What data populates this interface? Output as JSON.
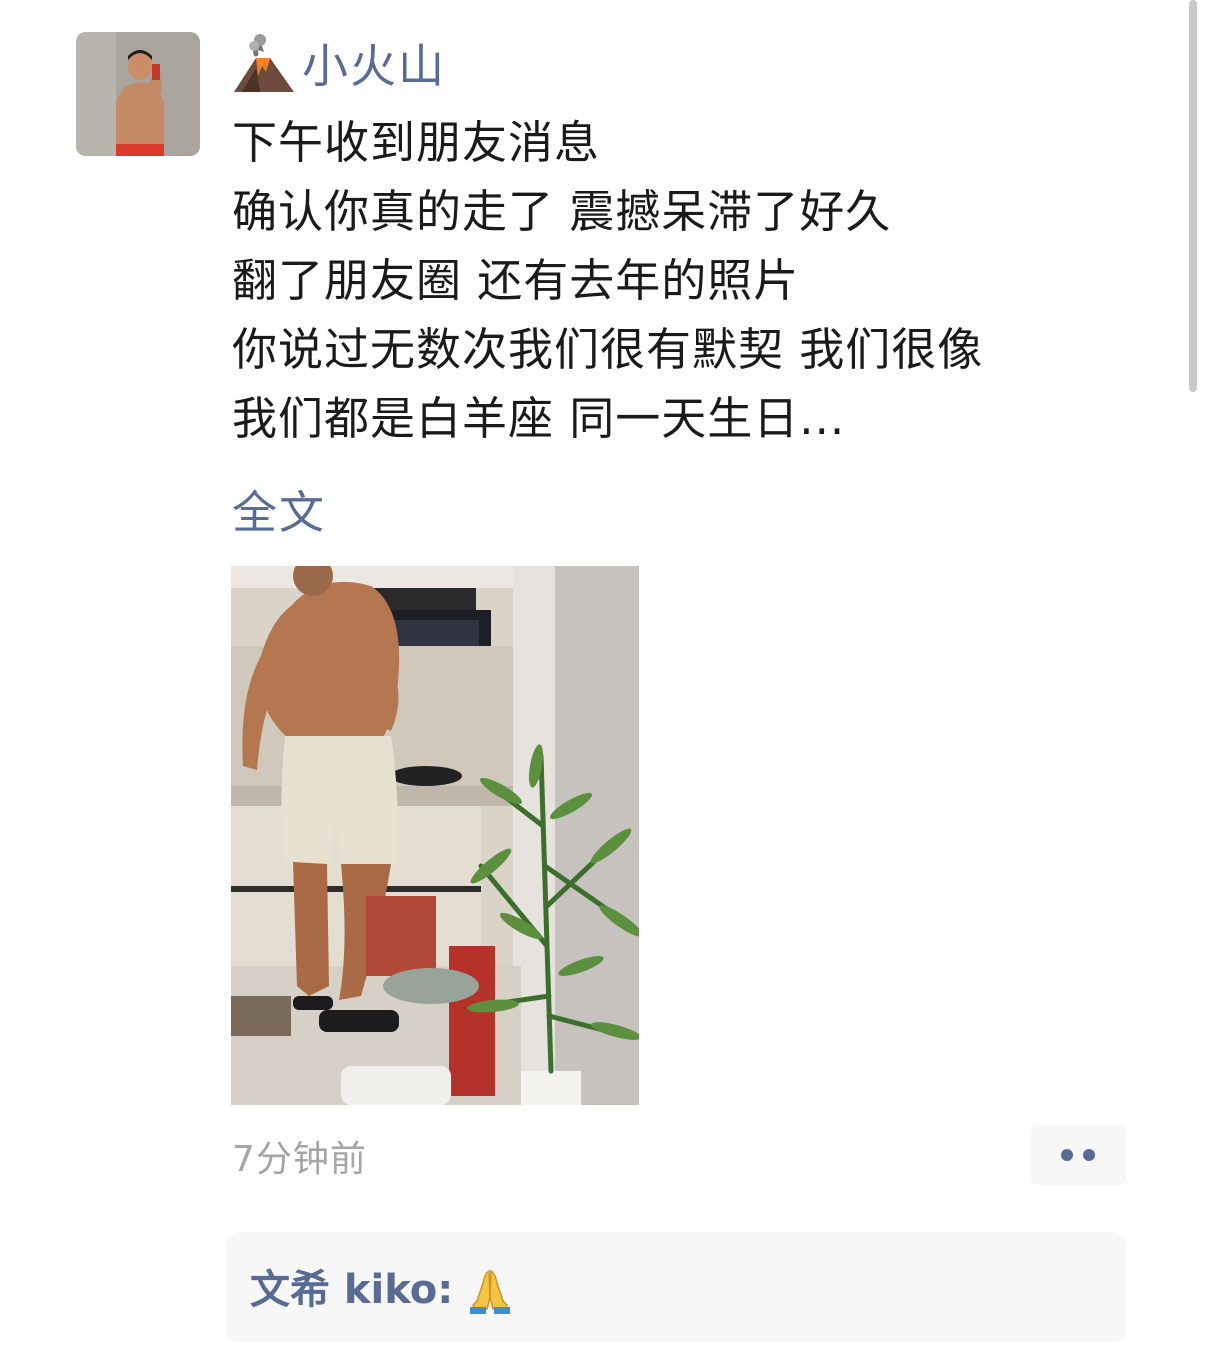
{
  "post": {
    "author": "小火山",
    "author_emoji": "volcano-icon",
    "lines": [
      "下午收到朋友消息",
      "确认你真的走了 震撼呆滞了好久",
      "翻了朋友圈  还有去年的照片",
      "你说过无数次我们很有默契 我们很像",
      "我们都是白羊座 同一天生日..."
    ],
    "full_text_link": "全文",
    "timestamp": "7分钟前"
  },
  "comments": [
    {
      "author": "文希 kiko",
      "separator": ":",
      "content_emoji": "folded-hands-icon"
    }
  ],
  "colors": {
    "link": "#576b95",
    "text": "#1a1a1a",
    "timestamp": "#a5a5a5",
    "comment_bg": "#f7f7f7"
  }
}
